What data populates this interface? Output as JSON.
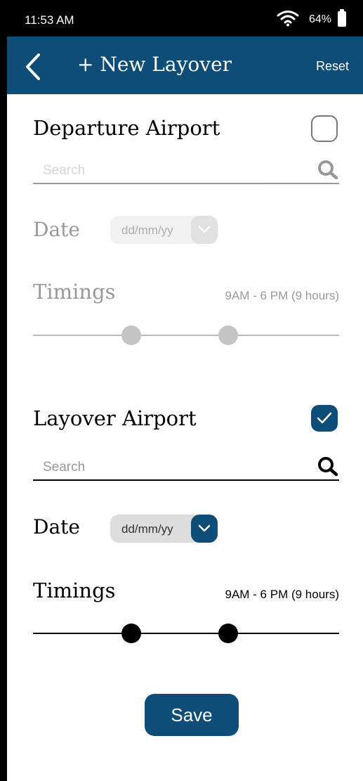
{
  "status_bar": {
    "time": "11:53 AM",
    "battery": "64%",
    "icons": [
      "wifi-icon",
      "battery-icon"
    ]
  },
  "header": {
    "back_icon": "chevron-left-icon",
    "title": "+ New Layover",
    "reset_label": "Reset"
  },
  "departure": {
    "title": "Departure Airport",
    "checked": false,
    "search_placeholder": "Search",
    "date_label": "Date",
    "date_placeholder": "dd/mm/yy",
    "timings_label": "Timings",
    "timings_range": "9AM - 6 PM (9 hours)"
  },
  "layover": {
    "title": "Layover Airport",
    "checked": true,
    "search_placeholder": "Search",
    "date_label": "Date",
    "date_placeholder": "dd/mm/yy",
    "timings_label": "Timings",
    "timings_range": "9AM - 6 PM (9 hours)"
  },
  "save_label": "Save",
  "colors": {
    "primary": "#0e4d77",
    "disabled": "#c4c4c4"
  }
}
